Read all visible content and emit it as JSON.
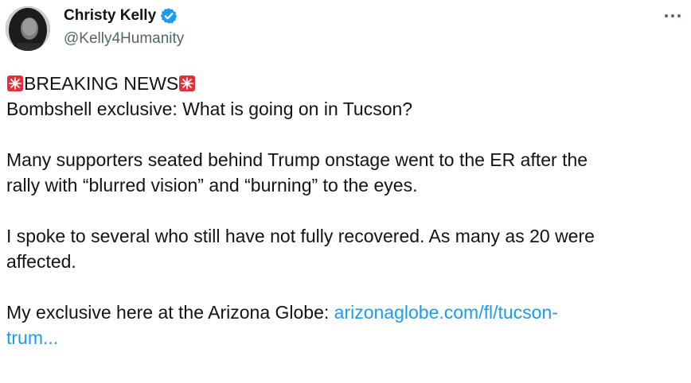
{
  "author": {
    "display_name": "Christy Kelly",
    "handle": "@Kelly4Humanity",
    "verified": true
  },
  "icons": {
    "avatar": "profile-photo",
    "verified": "verified-badge-icon",
    "more": "more-options-icon",
    "siren": "police-car-light-emoji"
  },
  "tweet": {
    "headline": "BREAKING NEWS",
    "line1": "Bombshell exclusive: What is going on in Tucson?",
    "para2_line1": "Many supporters seated behind Trump onstage went to the ER after the",
    "para2_line2": "rally with “blurred vision” and “burning” to the eyes.",
    "para3_line1": "I spoke to several who still have not fully recovered.  As many as 20 were",
    "para3_line2": "affected.",
    "para4_prefix": "My exclusive here at the Arizona Globe: ",
    "link_part1": "arizonaglobe.com/fl/tucson-",
    "link_part2": "trum..."
  },
  "colors": {
    "text": "#0f1419",
    "secondary": "#536471",
    "link": "#1d9bf0",
    "verified": "#1d9bf0",
    "siren": "#e0303e"
  }
}
